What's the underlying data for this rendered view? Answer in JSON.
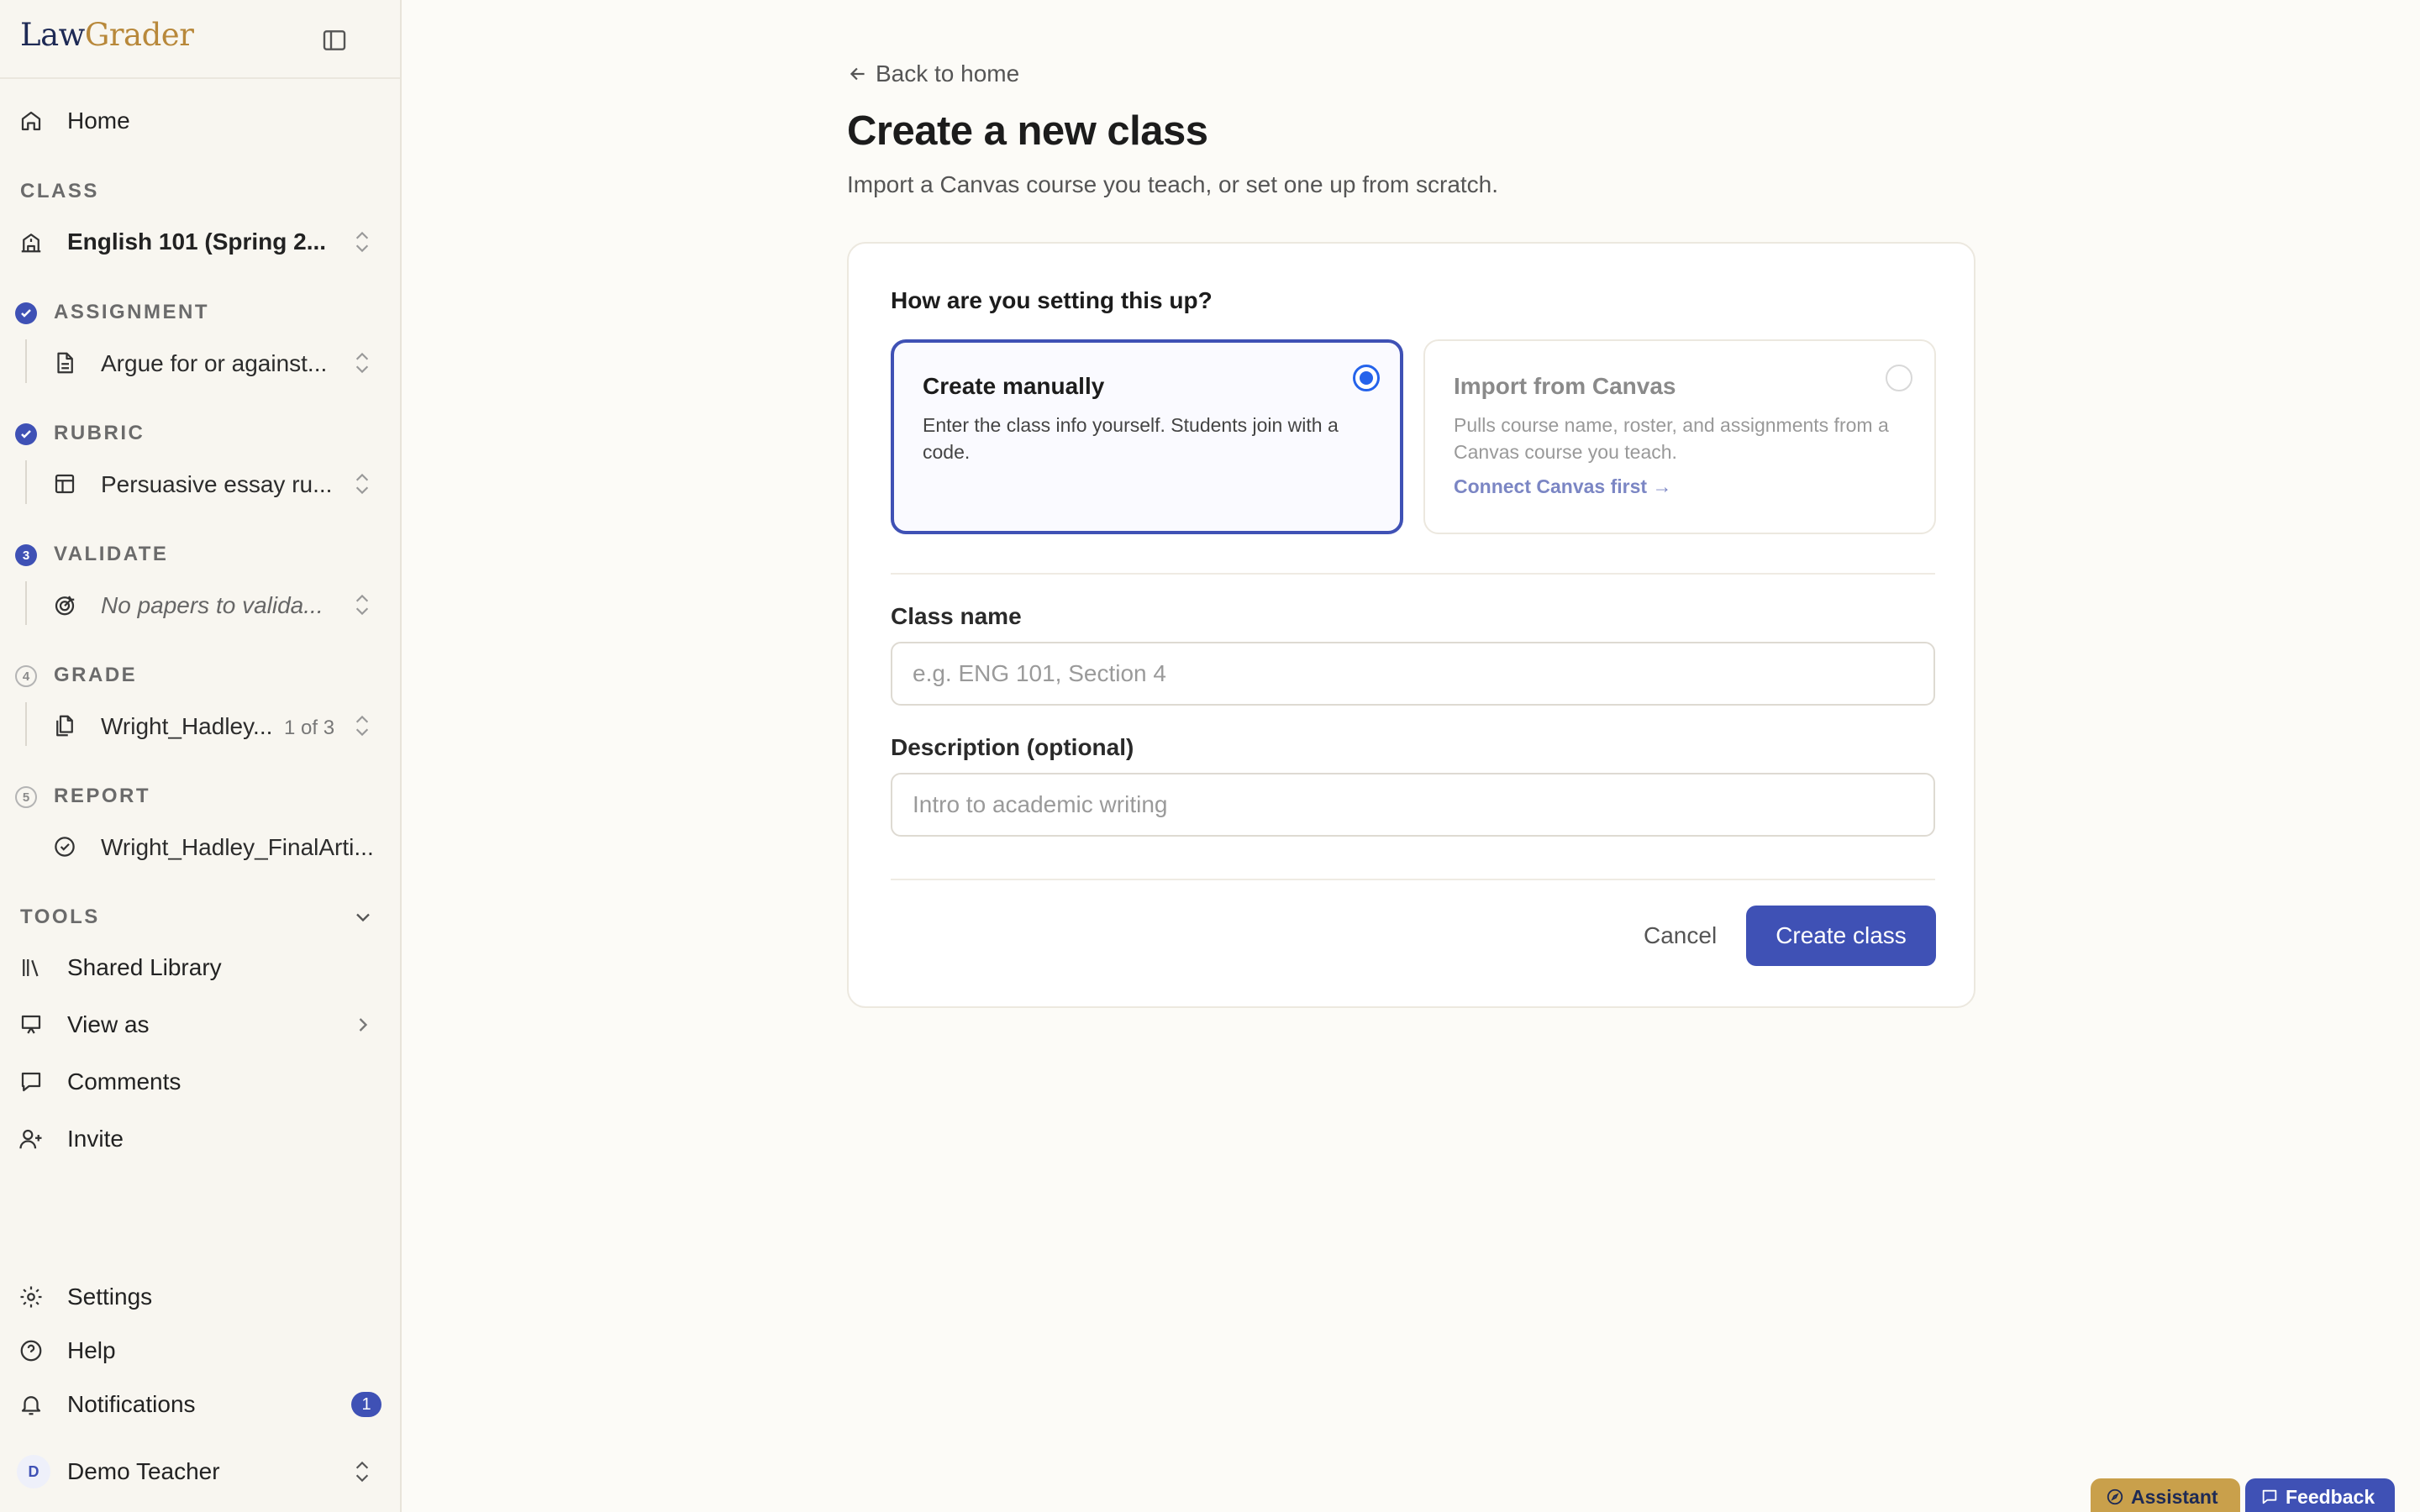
{
  "app": {
    "logo_part1": "Law",
    "logo_part2": "Grader"
  },
  "sidebar": {
    "home": "Home",
    "class_section": "CLASS",
    "class_value": "English 101 (Spring 2...",
    "steps": [
      {
        "badge": "",
        "label": "ASSIGNMENT",
        "value": "Argue for or against..."
      },
      {
        "badge": "",
        "label": "RUBRIC",
        "value": "Persuasive essay ru..."
      },
      {
        "badge": "3",
        "label": "VALIDATE",
        "value": "No papers to valida..."
      },
      {
        "badge": "4",
        "label": "GRADE",
        "value": "Wright_Hadley...",
        "extra": "1 of 3"
      },
      {
        "badge": "5",
        "label": "REPORT",
        "value": "Wright_Hadley_FinalArti..."
      }
    ],
    "tools_section": "TOOLS",
    "tools": [
      "Shared Library",
      "View as",
      "Comments",
      "Invite"
    ],
    "settings": "Settings",
    "help": "Help",
    "notifications": "Notifications",
    "notifications_count": "1",
    "user_initial": "D",
    "user_name": "Demo Teacher"
  },
  "main": {
    "back": "Back to home",
    "title": "Create a new class",
    "subtitle": "Import a Canvas course you teach, or set one up from scratch.",
    "question": "How are you setting this up?",
    "option_manual": {
      "title": "Create manually",
      "desc": "Enter the class info yourself. Students join with a code.",
      "selected": true
    },
    "option_canvas": {
      "title": "Import from Canvas",
      "desc": "Pulls course name, roster, and assignments from a Canvas course you teach.",
      "link": "Connect Canvas first →"
    },
    "class_name_label": "Class name",
    "class_name_placeholder": "e.g. ENG 101, Section 4",
    "class_name_value": "",
    "description_label": "Description (optional)",
    "description_placeholder": "Intro to academic writing",
    "description_value": "",
    "cancel": "Cancel",
    "create": "Create class"
  },
  "floating": {
    "assistant": "Assistant",
    "feedback": "Feedback"
  },
  "colors": {
    "accent": "#3f51b5",
    "radio": "#2563eb",
    "logo_navy": "#1e2a55",
    "logo_gold": "#b8883a",
    "background": "#fcfbf7"
  }
}
